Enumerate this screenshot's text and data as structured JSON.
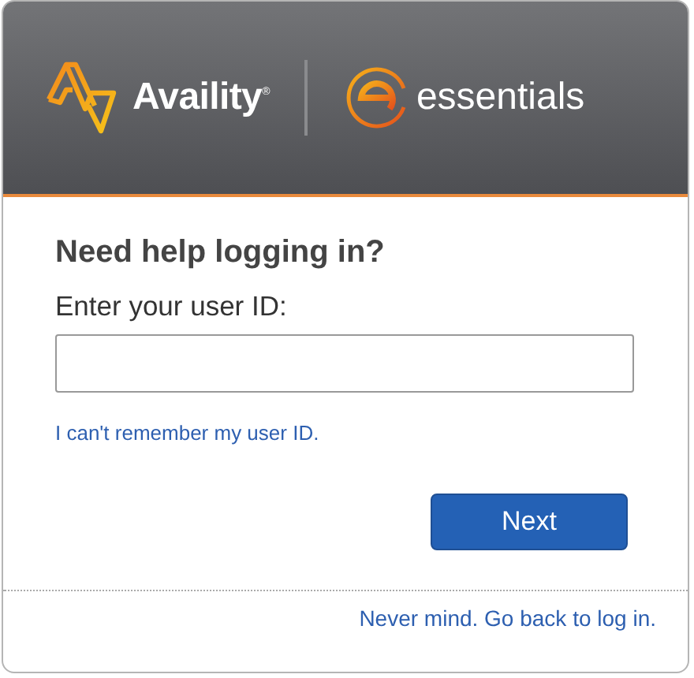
{
  "header": {
    "brand": "Availity$^{®}$",
    "product": "essentials"
  },
  "form": {
    "title": "Need help logging in?",
    "label": "Enter your user ID:",
    "help_link": "I can't remember my user ID.",
    "submit": "Next"
  },
  "footer": {
    "link": "Never mind. Go back to log in."
  }
}
